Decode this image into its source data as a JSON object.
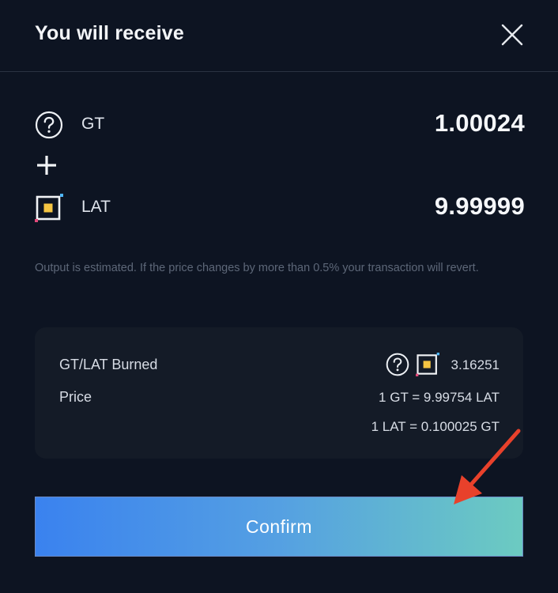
{
  "modal": {
    "title": "You will receive"
  },
  "tokens": [
    {
      "symbol": "GT",
      "amount": "1.00024",
      "icon": "question-circle-icon"
    },
    {
      "symbol": "LAT",
      "amount": "9.99999",
      "icon": "lat-token-icon"
    }
  ],
  "note": "Output is estimated. If the price changes by more than 0.5% your transaction will revert.",
  "summary": {
    "burned_label": "GT/LAT Burned",
    "burned_value": "3.16251",
    "price_label": "Price",
    "price_gt": "1 GT = 9.99754 LAT",
    "price_lat": "1 LAT = 0.100025 GT"
  },
  "confirm_label": "Confirm",
  "colors": {
    "background": "#0d1422",
    "panel": "#141b27",
    "button_gradient_start": "#3a82ef",
    "button_gradient_end": "#6ccbc1",
    "annotation_arrow": "#e8412b",
    "lat_square": "#f5c542"
  }
}
